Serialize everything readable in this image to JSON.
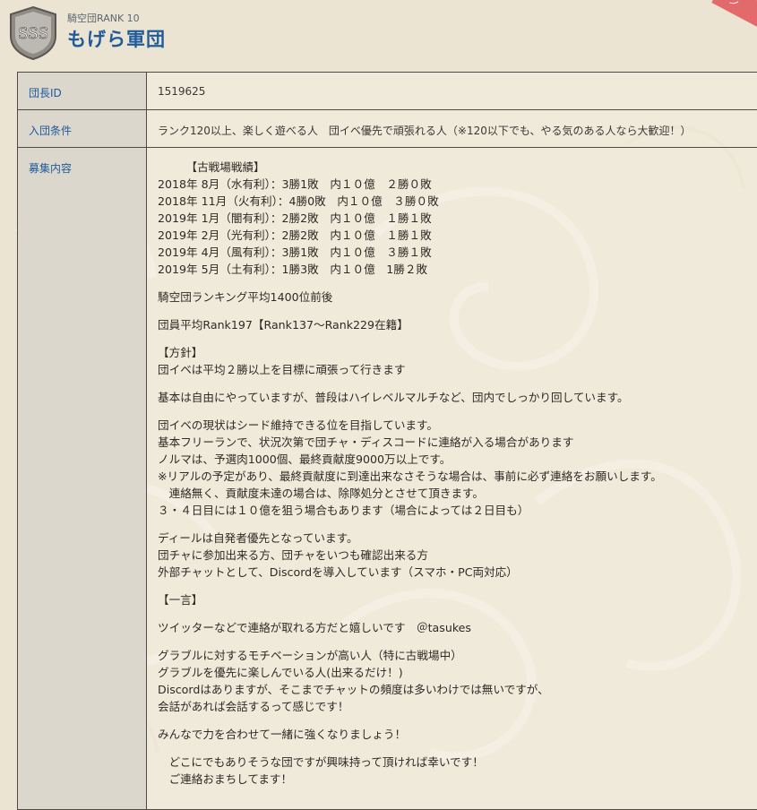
{
  "header": {
    "emblem_text": "SSS",
    "rank_label": "騎空団RANK 10",
    "team_name": "もげら軍団"
  },
  "table": {
    "rows": [
      {
        "label": "団長ID",
        "value": "1519625"
      },
      {
        "label": "入団条件",
        "value": "ランク120以上、楽しく遊べる人　団イベ優先で頑張れる人（※120以下でも、やる気のある人なら大歓迎！）"
      },
      {
        "label": "募集内容"
      }
    ],
    "recruit_paragraphs": [
      "　　　【古戦場戦績】\n2018年 8月（水有利）：3勝1敗　内１０億　２勝０敗\n2018年 11月（火有利）：4勝0敗　内１０億　３勝０敗\n2019年 1月（闇有利）：2勝2敗　内１０億　１勝１敗\n2019年 2月（光有利）：2勝2敗　内１０億　１勝１敗\n2019年 4月（風有利）：3勝1敗　内１０億　３勝１敗\n2019年 5月（土有利）：1勝3敗　内１０億　1勝２敗",
      "騎空団ランキング平均1400位前後",
      "団員平均Rank197【Rank137～Rank229在籍】",
      "【方針】\n団イベは平均２勝以上を目標に頑張って行きます",
      "基本は自由にやっていますが、普段はハイレベルマルチなど、団内でしっかり回しています。",
      "団イベの現状はシード維持できる位を目指しています。\n基本フリーランで、状況次第で団チャ・ディスコードに連絡が入る場合があります\nノルマは、予選肉1000個、最終貢献度9000万以上です。\n※リアルの予定があり、最終貢献度に到達出来なさそうな場合は、事前に必ず連絡をお願いします。\n　連絡無く、貢献度未達の場合は、除隊処分とさせて頂きます。\n３・４日目には１０億を狙う場合もあります（場合によっては２日目も）",
      "ディールは自発者優先となっています。\n団チャに参加出来る方、団チャをいつも確認出来る方\n外部チャットとして、Discordを導入しています（スマホ・PC両対応）",
      "【一言】",
      "ツイッターなどで連絡が取れる方だと嬉しいです　＠tasukes",
      "グラブルに対するモチベーションが高い人（特に古戦場中）\nグラブルを優先に楽しんでいる人(出来るだけ！)\nDiscordはありますが、そこまでチャットの頻度は多いわけでは無いですが、\n会話があれば会話するって感じです！",
      "みんなで力を合わせて一緒に強くなりましょう！",
      "　どこにでもありそうな団ですが興味持って頂ければ幸いです！\n　ご連絡おまちしてます！"
    ]
  },
  "colors": {
    "background": "#ebe4d2",
    "label_bg": "#dbd7cc",
    "accent_blue": "#1f5b9c",
    "border": "#4e4a45"
  },
  "icons": {
    "emblem": "sss-shield-emblem",
    "corner": "corner-ribbon-icon"
  }
}
